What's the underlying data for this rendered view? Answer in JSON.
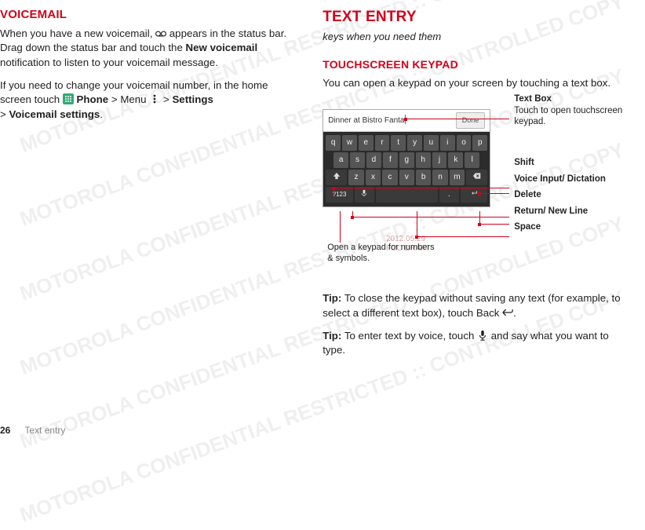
{
  "left": {
    "h1": "VOICEMAIL",
    "p1_a": "When you have a new voicemail, ",
    "p1_b": " appears in the status bar. Drag down the status bar and touch the ",
    "p1_bold1": "New voicemail",
    "p1_c": " notification to listen to your voicemail message.",
    "p2_a": "If you need to change your voicemail number, in the home screen touch ",
    "p2_phone": " Phone",
    "p2_gt1": " > ",
    "p2_menu": "Menu ",
    "p2_gt2": " > ",
    "p2_settings": "Settings",
    "p2_gt3": " > ",
    "p2_vm": "Voicemail settings",
    "p2_end": "."
  },
  "right": {
    "h2": "TEXT ENTRY",
    "subtitle": "keys when you need them",
    "h3": "TOUCHSCREEN KEYPAD",
    "intro": "You can open a keypad on your screen by touching a text box.",
    "tip1_label": "Tip:",
    "tip1_a": " To close the keypad without saving any text (for example, to select a different text box), touch Back ",
    "tip1_end": ".",
    "tip2_label": "Tip:",
    "tip2_a": " To enter text by voice, touch ",
    "tip2_b": " and say what you want to type."
  },
  "keypad": {
    "textbox_value": "Dinner at Bistro Fanta",
    "done": "Done",
    "row1": [
      "q",
      "w",
      "e",
      "r",
      "t",
      "y",
      "u",
      "i",
      "o",
      "p"
    ],
    "row2": [
      "a",
      "s",
      "d",
      "f",
      "g",
      "h",
      "j",
      "k",
      "l"
    ],
    "row3_letters": [
      "z",
      "x",
      "c",
      "v",
      "b",
      "n",
      "m"
    ],
    "sym_key": "?123",
    "period_key": ".",
    "under_caption": "Open a keypad for numbers & symbols."
  },
  "callouts": {
    "textbox_t": "Text Box",
    "textbox_d": "Touch to open touchscreen keypad.",
    "shift": "Shift",
    "voice": "Voice Input/ Dictation",
    "delete": "Delete",
    "return": "Return/ New Line",
    "space": "Space"
  },
  "footer": {
    "page": "26",
    "section": "Text entry"
  },
  "draft": {
    "l1": "2012.05.29",
    "l2": "FCC DRAFT"
  },
  "watermark_text": "MOTOROLA CONFIDENTIAL RESTRICTED :: CONTROLLED COPY"
}
